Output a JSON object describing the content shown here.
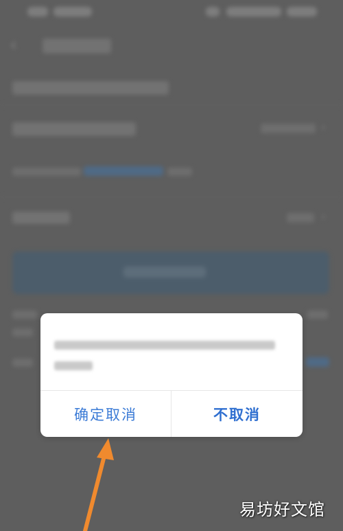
{
  "dialog": {
    "confirm_label": "确定取消",
    "keep_label": "不取消"
  },
  "watermark": {
    "text": "易坊好文馆"
  },
  "colors": {
    "dialog_button_text": "#2f6fd0",
    "annotation_arrow": "#f08a2e",
    "overlay_dim": "#5e5e5e"
  }
}
